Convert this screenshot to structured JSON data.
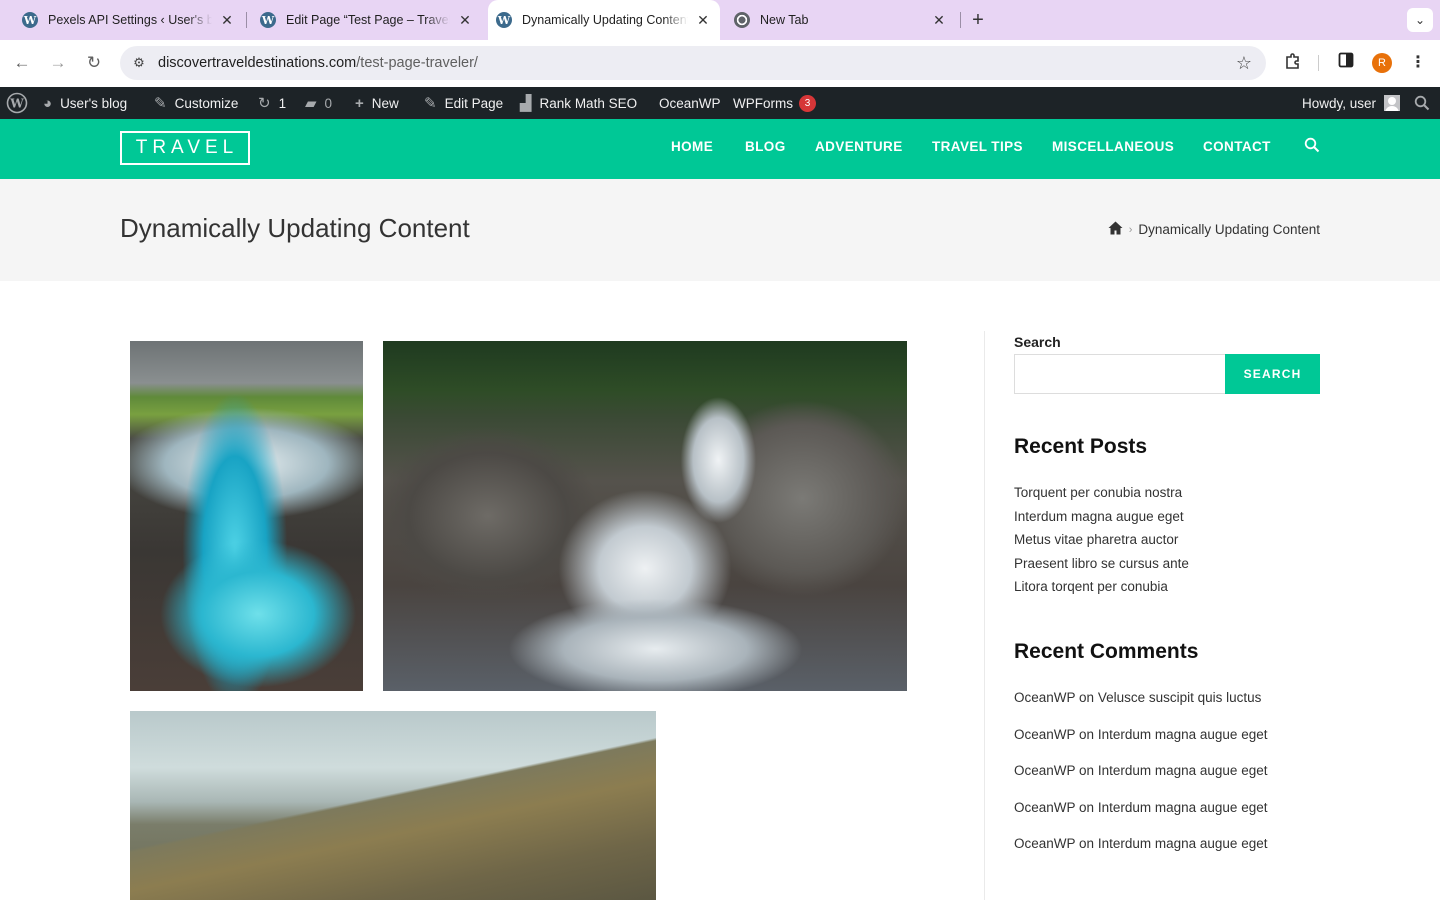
{
  "browser": {
    "tabs": [
      {
        "title": "Pexels API Settings ‹ User's blog",
        "close": "✕"
      },
      {
        "title": "Edit Page “Test Page – Traveler”",
        "close": "✕"
      },
      {
        "title": "Dynamically Updating Content",
        "close": "✕"
      },
      {
        "title": "New Tab",
        "close": "✕"
      }
    ],
    "new_tab": "+",
    "tab_menu": "⌄",
    "url_domain": "discovertraveldestinations.com",
    "url_path": "/test-page-traveler/",
    "profile_initial": "R"
  },
  "adminbar": {
    "site": "User's blog",
    "customize": "Customize",
    "updates_count": "1",
    "comments_count": "0",
    "new": "New",
    "edit_page": "Edit Page",
    "rank_math": "Rank Math SEO",
    "oceanwp": "OceanWP",
    "wpforms": "WPForms",
    "wpforms_badge": "3",
    "howdy": "Howdy, user"
  },
  "site": {
    "logo": "TRAVEL",
    "menu": [
      "HOME",
      "BLOG",
      "ADVENTURE",
      "TRAVEL TIPS",
      "MISCELLANEOUS",
      "CONTACT"
    ],
    "accent_color": "#00c896"
  },
  "page": {
    "title": "Dynamically Updating Content",
    "breadcrumb_current": "Dynamically Updating Content"
  },
  "sidebar": {
    "search_label": "Search",
    "search_button": "SEARCH",
    "recent_posts_title": "Recent Posts",
    "recent_posts": [
      "Torquent per conubia nostra",
      "Interdum magna augue eget",
      "Metus vitae pharetra auctor",
      "Praesent libro se cursus ante",
      "Litora torqent per conubia"
    ],
    "recent_comments_title": "Recent Comments",
    "recent_comments": [
      {
        "author": "OceanWP",
        "on": "on",
        "post": "Velusce suscipit quis luctus"
      },
      {
        "author": "OceanWP",
        "on": "on",
        "post": "Interdum magna augue eget"
      },
      {
        "author": "OceanWP",
        "on": "on",
        "post": "Interdum magna augue eget"
      },
      {
        "author": "OceanWP",
        "on": "on",
        "post": "Interdum magna augue eget"
      },
      {
        "author": "OceanWP",
        "on": "on",
        "post": "Interdum magna augue eget"
      }
    ]
  }
}
